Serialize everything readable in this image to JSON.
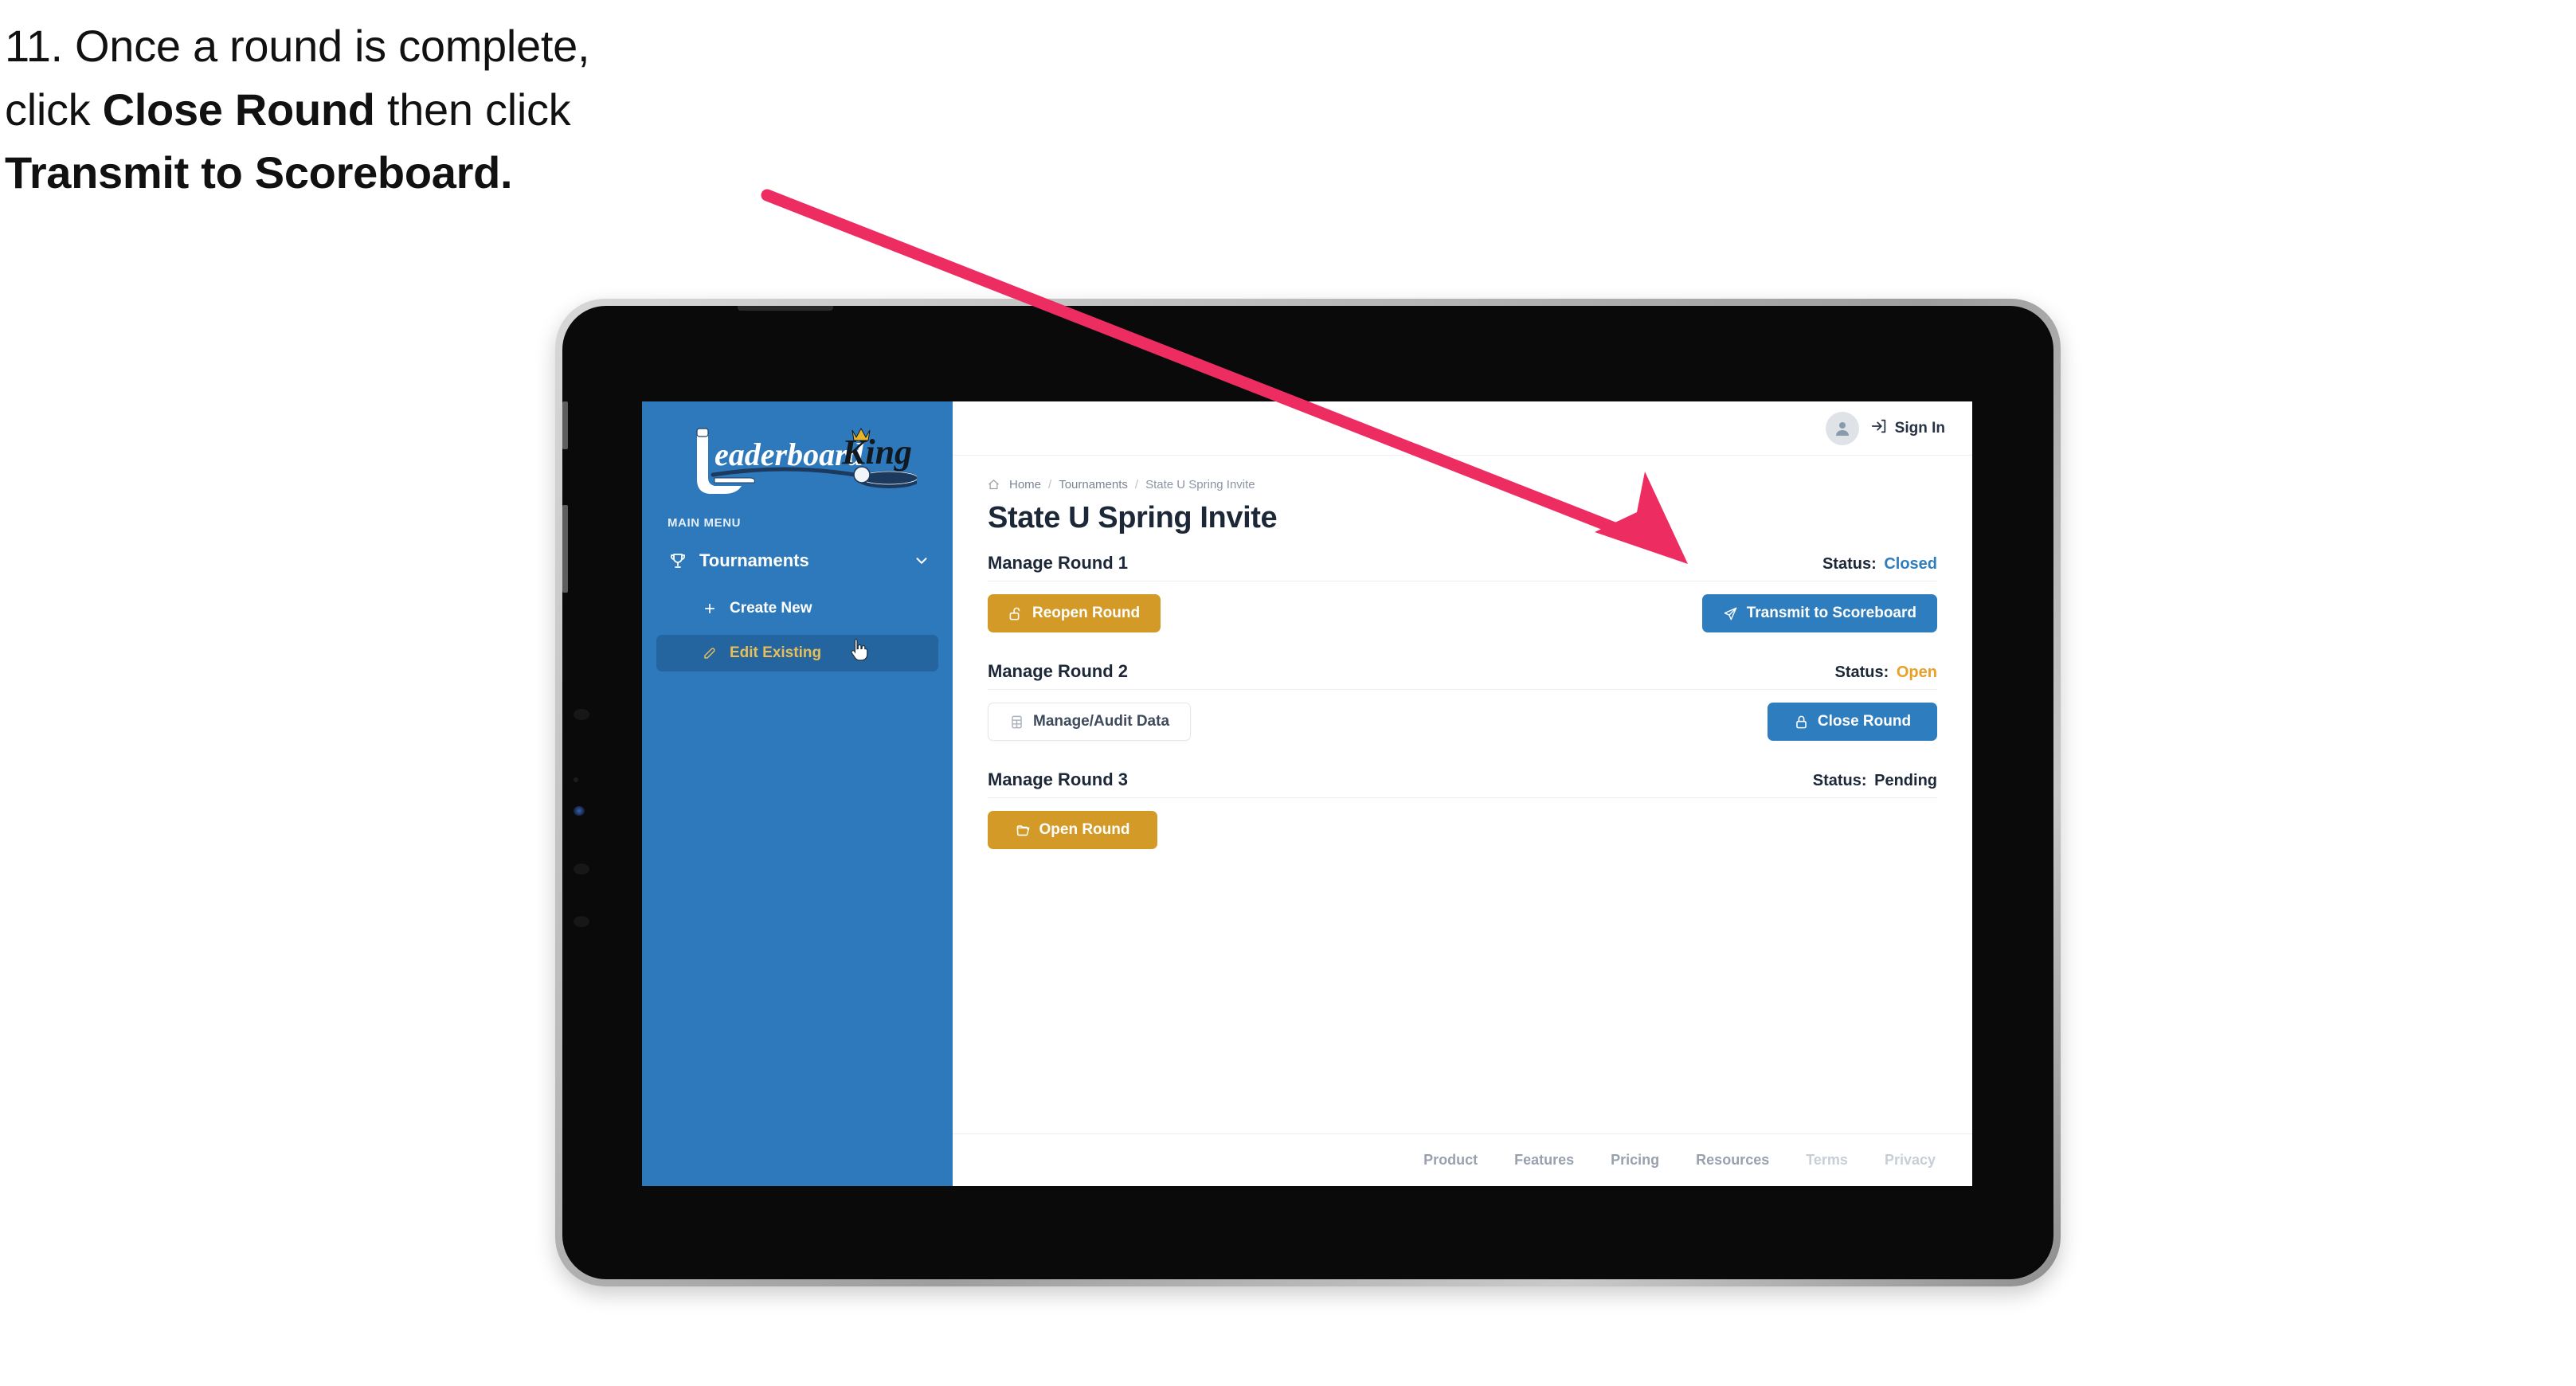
{
  "caption": {
    "line1_prefix": "11. Once a round is complete,",
    "line2_prefix": "click ",
    "line2_bold": "Close Round",
    "line2_suffix": " then click",
    "line3_bold": "Transmit to Scoreboard."
  },
  "annotation": {
    "arrow_color": "#ED2D62"
  },
  "colors": {
    "sidebar_blue": "#2E79BC",
    "sidebar_active": "#24649F",
    "sidebar_active_text": "#E6BF5A",
    "button_gold": "#D49A28",
    "button_blue": "#2E7DBE",
    "status_closed": "#2E7DBE",
    "status_open": "#E8A027",
    "status_pending": "#1C2738",
    "page_title": "#1C2738"
  },
  "sidebar": {
    "logo_primary": "Leaderboard",
    "logo_secondary": "King",
    "menu_label": "MAIN MENU",
    "nav": {
      "label": "Tournaments",
      "icon": "trophy-icon",
      "chevron": "chevron-down-icon"
    },
    "sub_items": [
      {
        "label": "Create New",
        "icon": "plus-icon",
        "active": false
      },
      {
        "label": "Edit Existing",
        "icon": "edit-pencil-icon",
        "active": true
      }
    ],
    "cursor": "hand-pointer-cursor"
  },
  "topbar": {
    "avatar": "user-avatar-icon",
    "signin_icon": "sign-in-arrow-icon",
    "signin_label": "Sign In"
  },
  "breadcrumb": {
    "home_icon": "home-icon",
    "items": [
      "Home",
      "Tournaments",
      "State U Spring Invite"
    ],
    "separator": "/"
  },
  "page": {
    "title": "State U Spring Invite"
  },
  "rounds": [
    {
      "name": "Manage Round 1",
      "status_label": "Status:",
      "status_value": "Closed",
      "status_color": "#2E7DBE",
      "left_button": {
        "label": "Reopen Round",
        "icon": "unlock-icon",
        "style": "gold"
      },
      "right_button": {
        "label": "Transmit to Scoreboard",
        "icon": "paper-plane-icon",
        "style": "blue"
      }
    },
    {
      "name": "Manage Round 2",
      "status_label": "Status:",
      "status_value": "Open",
      "status_color": "#E8A027",
      "left_button": {
        "label": "Manage/Audit Data",
        "icon": "table-grid-icon",
        "style": "ghost"
      },
      "right_button": {
        "label": "Close Round",
        "icon": "lock-icon",
        "style": "blue"
      }
    },
    {
      "name": "Manage Round 3",
      "status_label": "Status:",
      "status_value": "Pending",
      "status_color": "#1C2738",
      "left_button": {
        "label": "Open Round",
        "icon": "folder-open-icon",
        "style": "gold"
      },
      "right_button": null
    }
  ],
  "footer": {
    "links": [
      {
        "label": "Product",
        "muted": false
      },
      {
        "label": "Features",
        "muted": false
      },
      {
        "label": "Pricing",
        "muted": false
      },
      {
        "label": "Resources",
        "muted": false
      },
      {
        "label": "Terms",
        "muted": true
      },
      {
        "label": "Privacy",
        "muted": true
      }
    ]
  }
}
